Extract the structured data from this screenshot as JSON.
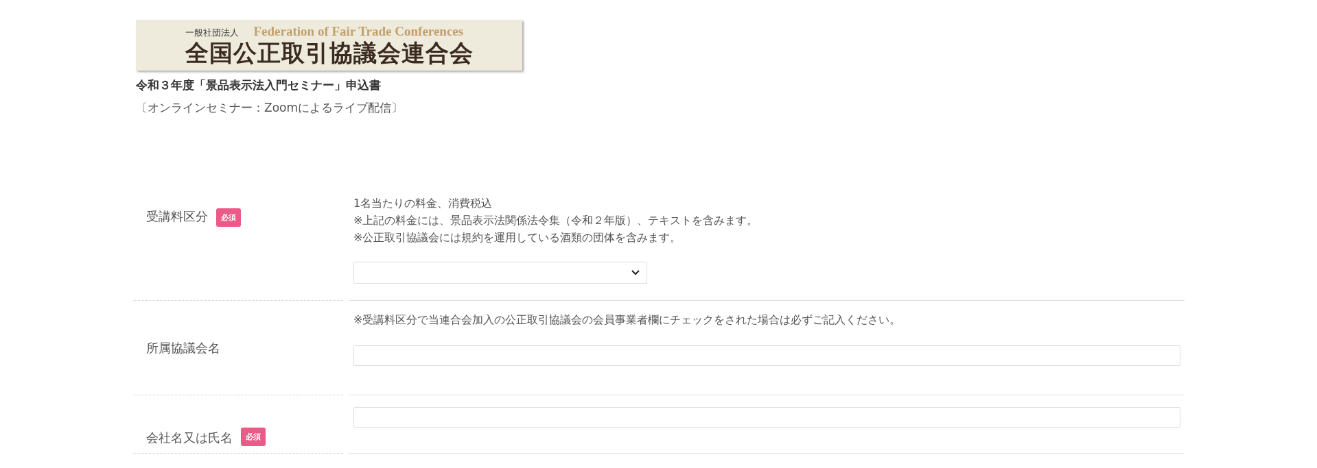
{
  "logo": {
    "org_type": "一般社団法人",
    "english_name": "Federation of Fair Trade Conferences",
    "name": "全国公正取引協議会連合会"
  },
  "title": "令和３年度「景品表示法入門セミナー」申込書",
  "subtitle": "〔オンラインセミナー：Zoomによるライブ配信〕",
  "fields": [
    {
      "label": "受講料区分",
      "required": true,
      "required_badge": "必須",
      "kind": "select",
      "notes": [
        "1名当たりの料金、消費税込",
        "※上記の料金には、景品表示法関係法令集（令和２年版）、テキストを含みます。",
        "※公正取引協議会には規約を運用している酒類の団体を含みます。"
      ]
    },
    {
      "label": "所属協議会名",
      "required": false,
      "kind": "text",
      "notes": [
        "※受講料区分で当連合会加入の公正取引協議会の会員事業者欄にチェックをされた場合は必ずご記入ください。"
      ]
    },
    {
      "label": "会社名又は氏名",
      "required": true,
      "required_badge": "必須",
      "kind": "text"
    }
  ]
}
